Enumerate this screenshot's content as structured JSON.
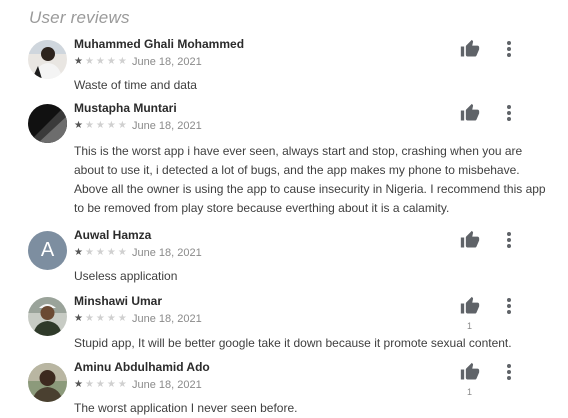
{
  "section_title": "User reviews",
  "reviews": [
    {
      "name": "Muhammed Ghali Mohammed",
      "rating": 1,
      "stars": "★★★★★",
      "date": "June 18, 2021",
      "text": "Waste of time and data",
      "avatar": "photo",
      "helpful_count": ""
    },
    {
      "name": "Mustapha Muntari",
      "rating": 1,
      "stars": "★★★★★",
      "date": "June 18, 2021",
      "text": "This is the worst app i have ever seen, always start and stop, crashing when you are about to use it, i detected a lot of bugs, and the app makes my phone to misbehave. Above all the owner is using the app to cause insecurity in Nigeria. I recommend this app to be removed from play store because everthing about it is a calamity.",
      "avatar": "dark-photo",
      "helpful_count": ""
    },
    {
      "name": "Auwal Hamza",
      "rating": 1,
      "stars": "★★★★★",
      "date": "June 18, 2021",
      "text": "Useless application",
      "avatar": "letter",
      "avatar_letter": "A",
      "avatar_color": "#7d8ea0",
      "helpful_count": ""
    },
    {
      "name": "Minshawi Umar",
      "rating": 1,
      "stars": "★★★★★",
      "date": "June 18, 2021",
      "text": "Stupid app, It will be better google take it down because it promote sexual content.",
      "avatar": "photo",
      "helpful_count": "1"
    },
    {
      "name": "Aminu Abdulhamid Ado",
      "rating": 1,
      "stars": "★★★★★",
      "date": "June 18, 2021",
      "text": "The worst application I never seen before.",
      "avatar": "photo",
      "helpful_count": "1"
    }
  ],
  "icons": {
    "helpful": "thumbs-up-icon",
    "menu": "more-vert-icon"
  },
  "colors": {
    "icon": "#5f6368",
    "star_filled": "#555555",
    "star_empty": "#d0d0d0"
  }
}
